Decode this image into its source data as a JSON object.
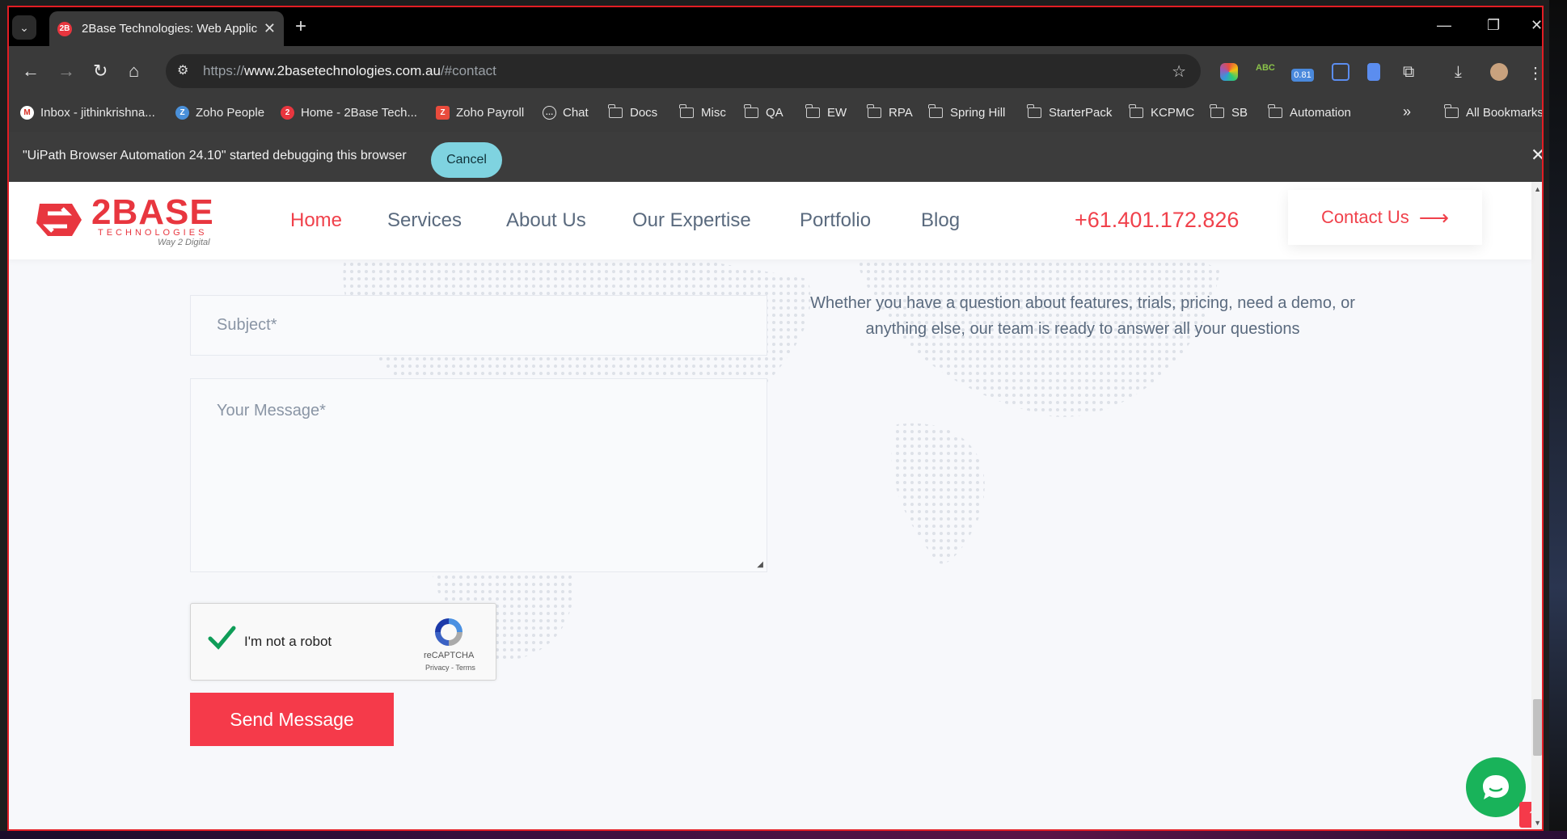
{
  "browser": {
    "tab_title": "2Base Technologies: Web Applic",
    "tab_favicon": "2B",
    "url_scheme": "https://",
    "url_host": "www.2basetechnologies.com.au",
    "url_path": "/#contact",
    "zoom_badge": "0.81"
  },
  "bookmarks": [
    {
      "label": "Inbox - jithinkrishna...",
      "icon": "gmail-icon"
    },
    {
      "label": "Zoho People",
      "icon": "zoho-people-icon"
    },
    {
      "label": "Home - 2Base Tech...",
      "icon": "2base-icon"
    },
    {
      "label": "Zoho Payroll",
      "icon": "zoho-payroll-icon"
    },
    {
      "label": "Chat",
      "icon": "chat-icon"
    },
    {
      "label": "Docs",
      "icon": "folder-icon"
    },
    {
      "label": "Misc",
      "icon": "folder-icon"
    },
    {
      "label": "QA",
      "icon": "folder-icon"
    },
    {
      "label": "EW",
      "icon": "folder-icon"
    },
    {
      "label": "RPA",
      "icon": "folder-icon"
    },
    {
      "label": "Spring Hill",
      "icon": "folder-icon"
    },
    {
      "label": "StarterPack",
      "icon": "folder-icon"
    },
    {
      "label": "KCPMC",
      "icon": "folder-icon"
    },
    {
      "label": "SB",
      "icon": "folder-icon"
    },
    {
      "label": "Automation",
      "icon": "folder-icon"
    }
  ],
  "bookmarks_more": "»",
  "all_bookmarks": "All Bookmarks",
  "debug": {
    "message": "\"UiPath Browser Automation 24.10\" started debugging this browser",
    "cancel_label": "Cancel"
  },
  "site": {
    "logo_main": "2BASE",
    "logo_sub": "TECHNOLOGIES",
    "logo_tagline": "Way 2 Digital",
    "nav": [
      "Home",
      "Services",
      "About Us",
      "Our Expertise",
      "Portfolio",
      "Blog"
    ],
    "phone": "+61.401.172.826",
    "contact_label": "Contact Us",
    "brand_color": "#f0414b"
  },
  "form": {
    "subject_placeholder": "Subject*",
    "message_placeholder": "Your Message*",
    "captcha_label": "I'm not a robot",
    "captcha_brand": "reCAPTCHA",
    "captcha_links": "Privacy - Terms",
    "send_label": "Send Message"
  },
  "intro_text": "Whether you have a question about features, trials, pricing, need a demo, or anything else, our team is ready to answer all your questions"
}
